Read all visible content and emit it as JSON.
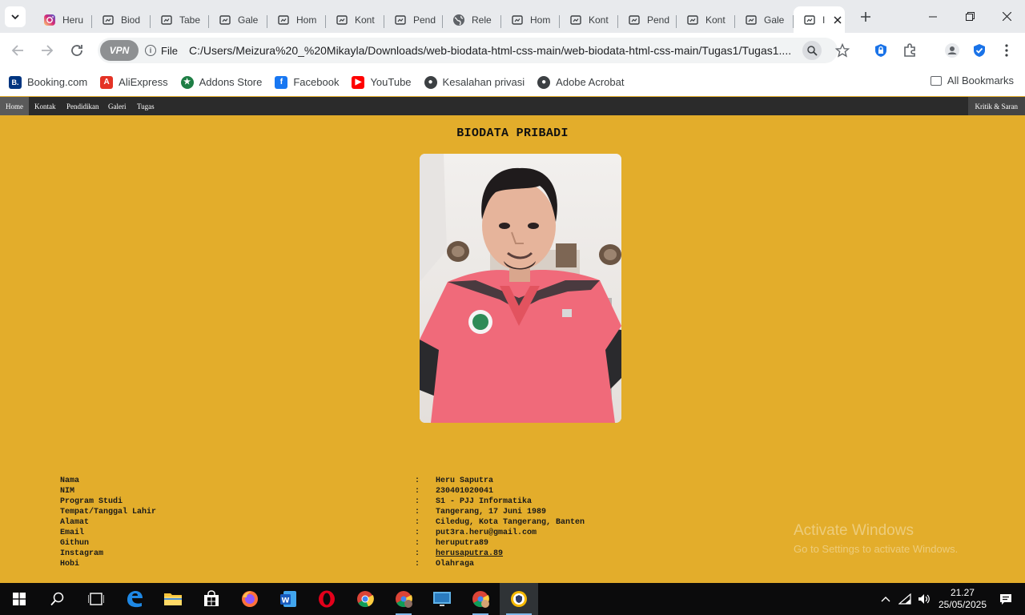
{
  "browser": {
    "tabs": [
      {
        "title": "Heru",
        "icon": "instagram-icon"
      },
      {
        "title": "Biod",
        "icon": "page-icon"
      },
      {
        "title": "Tabe",
        "icon": "page-icon"
      },
      {
        "title": "Gale",
        "icon": "page-icon"
      },
      {
        "title": "Hom",
        "icon": "page-icon"
      },
      {
        "title": "Kont",
        "icon": "page-icon"
      },
      {
        "title": "Pend",
        "icon": "page-icon"
      },
      {
        "title": "Rele",
        "icon": "globe-icon"
      },
      {
        "title": "Hom",
        "icon": "page-icon"
      },
      {
        "title": "Kont",
        "icon": "page-icon"
      },
      {
        "title": "Pend",
        "icon": "page-icon"
      },
      {
        "title": "Kont",
        "icon": "page-icon"
      },
      {
        "title": "Gale",
        "icon": "page-icon"
      },
      {
        "title": "I",
        "icon": "page-icon",
        "active": true
      }
    ],
    "vpn_label": "VPN",
    "file_label": "File",
    "url": "C:/Users/Meizura%20_%20Mikayla/Downloads/web-biodata-html-css-main/web-biodata-html-css-main/Tugas1/Tugas1....",
    "bookmarks": [
      {
        "label": "Booking.com",
        "icon": "booking-icon",
        "color": "#003580"
      },
      {
        "label": "AliExpress",
        "icon": "aliexpress-icon",
        "color": "#e43225"
      },
      {
        "label": "Addons Store",
        "icon": "addons-store-icon",
        "color": "#1e7e45"
      },
      {
        "label": "Facebook",
        "icon": "facebook-icon",
        "color": "#1877f2"
      },
      {
        "label": "YouTube",
        "icon": "youtube-icon",
        "color": "#ff0000"
      },
      {
        "label": "Kesalahan privasi",
        "icon": "privacy-error-icon",
        "color": "#3c4043"
      },
      {
        "label": "Adobe Acrobat",
        "icon": "adobe-acrobat-icon",
        "color": "#3c4043"
      }
    ],
    "all_bookmarks_label": "All Bookmarks"
  },
  "page": {
    "nav": {
      "home": "Home",
      "kontak": "Kontak",
      "pendidikan": "Pendidikan",
      "galeri": "Galeri",
      "tugas": "Tugas",
      "kritik": "Kritik & Saran"
    },
    "title": "BIODATA PRIBADI",
    "separator": ":",
    "biodata": [
      {
        "label": "Nama",
        "value": "Heru Saputra"
      },
      {
        "label": "NIM",
        "value": "230401020041"
      },
      {
        "label": "Program Studi",
        "value": "S1 - PJJ Informatika"
      },
      {
        "label": "Tempat/Tanggal Lahir",
        "value": "Tangerang, 17 Juni 1989"
      },
      {
        "label": "Alamat",
        "value": "Ciledug, Kota Tangerang, Banten"
      },
      {
        "label": "Email",
        "value": "put3ra.heru@gmail.com"
      },
      {
        "label": "Githun",
        "value": "heruputra89"
      },
      {
        "label": "Instagram",
        "value": "herusaputra.89"
      },
      {
        "label": "Hobi",
        "value": "Olahraga"
      }
    ]
  },
  "watermark": {
    "title": "Activate Windows",
    "subtitle": "Go to Settings to activate Windows."
  },
  "taskbar": {
    "time": "21.27",
    "date": "25/05/2025"
  }
}
